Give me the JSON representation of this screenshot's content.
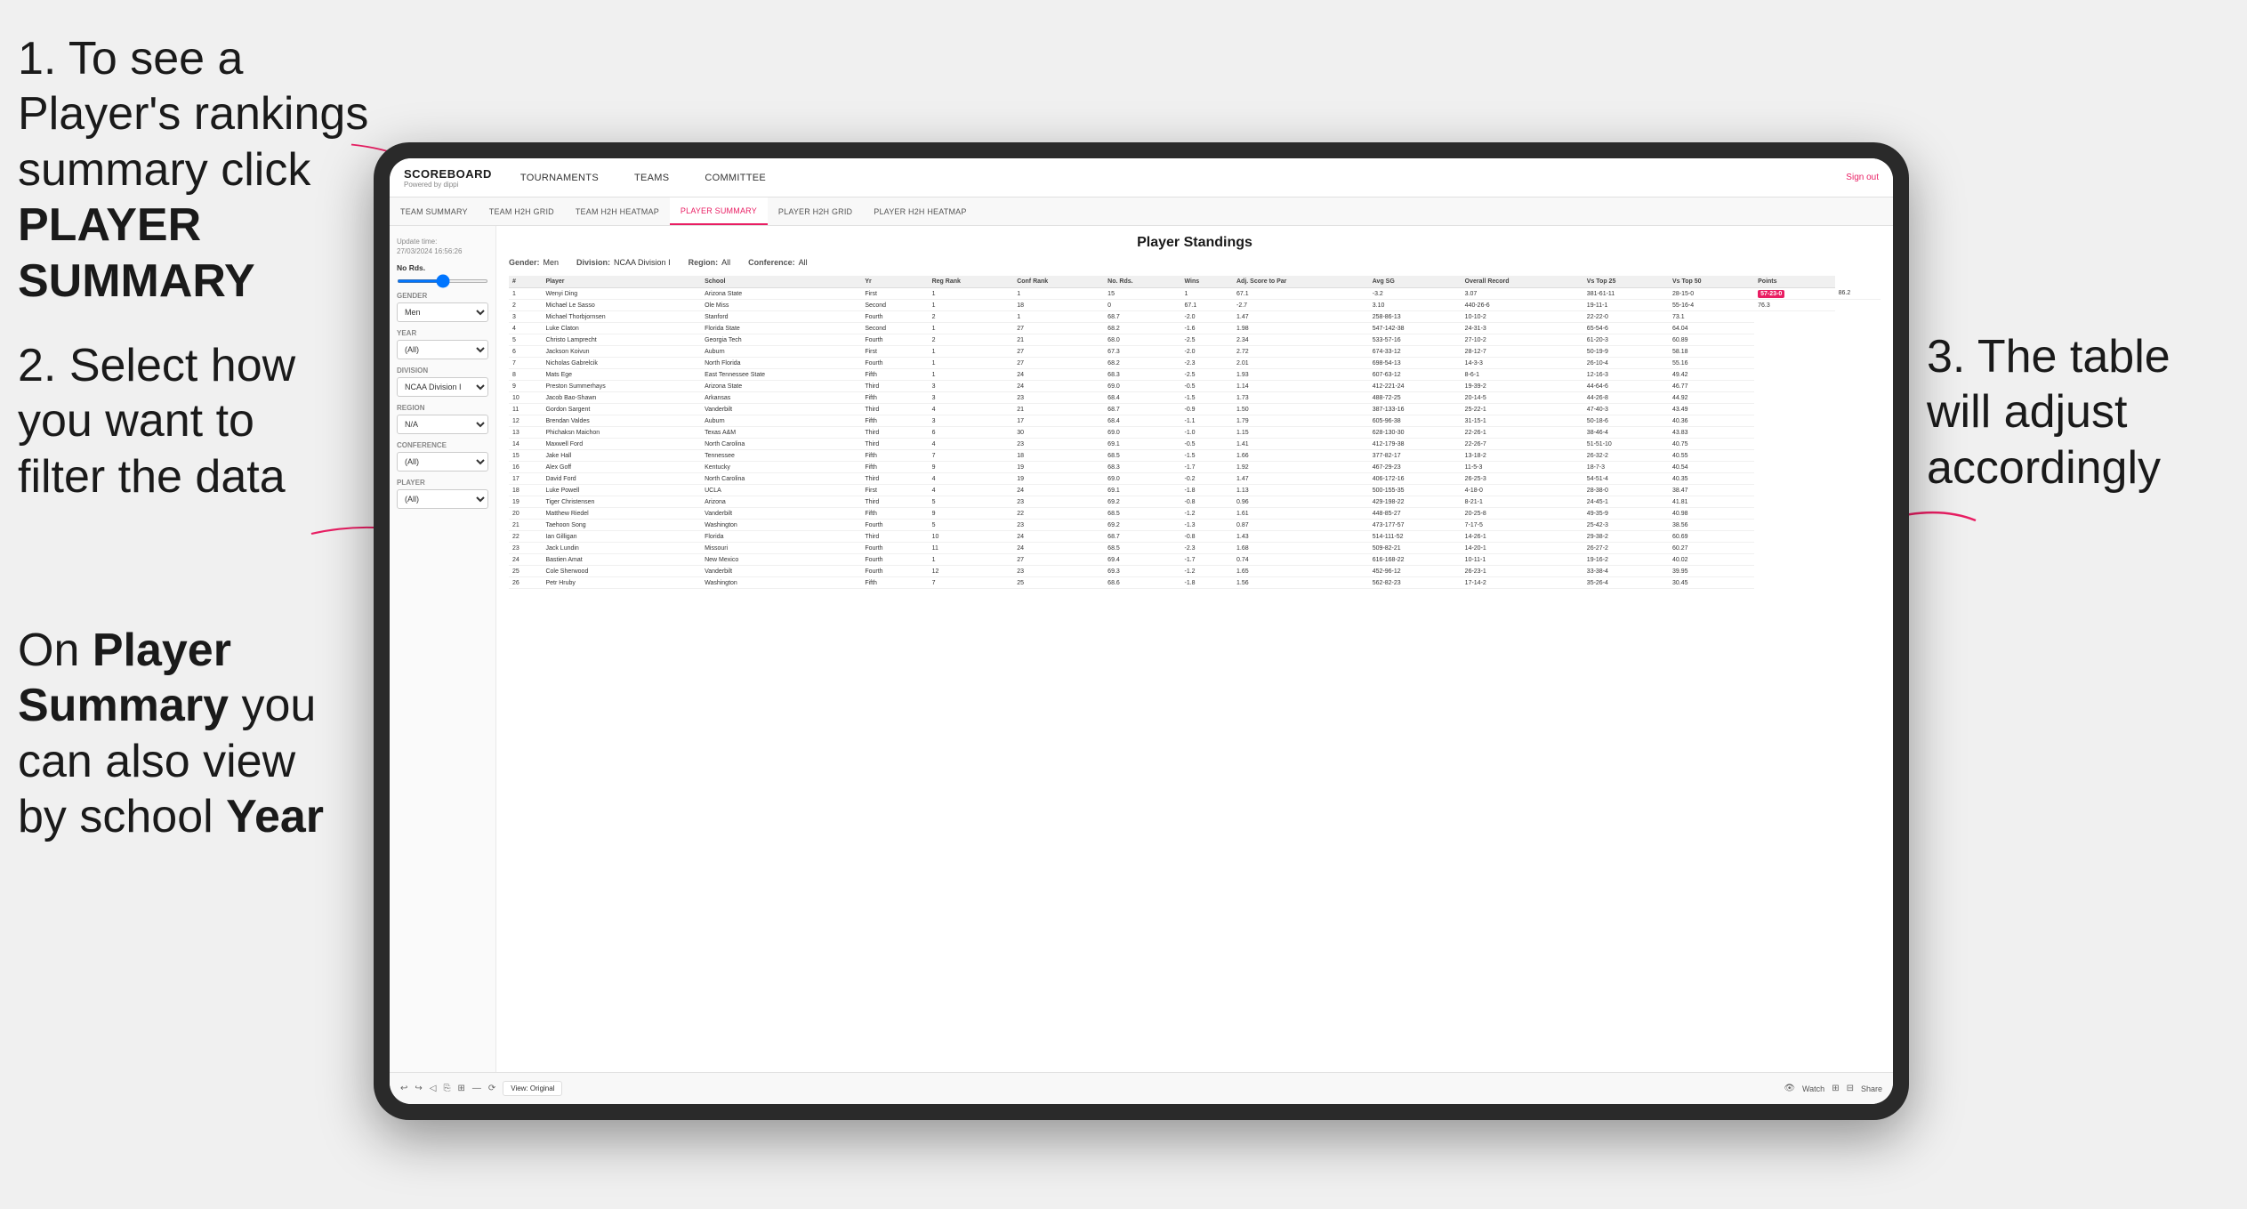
{
  "instructions": {
    "step1": "1. To see a Player's rankings summary click ",
    "step1_bold": "PLAYER SUMMARY",
    "step2": "2. Select how you want to filter the data",
    "step_bottom": "On ",
    "step_bottom_bold1": "Player Summary",
    "step_bottom_text": " you can also view by school ",
    "step_bottom_bold2": "Year",
    "step3": "3. The table will adjust accordingly"
  },
  "header": {
    "logo_title": "SCOREBOARD",
    "logo_sub": "Powered by dippi",
    "nav_items": [
      "TOURNAMENTS",
      "TEAMS",
      "COMMITTEE"
    ],
    "sign_in": "Sign out"
  },
  "sub_nav": {
    "items": [
      "TEAM SUMMARY",
      "TEAM H2H GRID",
      "TEAM H2H HEATMAP",
      "PLAYER SUMMARY",
      "PLAYER H2H GRID",
      "PLAYER H2H HEATMAP"
    ],
    "active": "PLAYER SUMMARY"
  },
  "sidebar": {
    "update_label": "Update time:",
    "update_time": "27/03/2024 16:56:26",
    "no_rds_label": "No Rds.",
    "gender_label": "Gender",
    "gender_value": "Men",
    "year_label": "Year",
    "year_value": "(All)",
    "division_label": "Division",
    "division_value": "NCAA Division I",
    "region_label": "Region",
    "region_value": "N/A",
    "conference_label": "Conference",
    "conference_value": "(All)",
    "player_label": "Player",
    "player_value": "(All)"
  },
  "standings": {
    "title": "Player Standings",
    "gender": "Men",
    "division": "NCAA Division I",
    "region": "All",
    "conference": "All",
    "columns": [
      "#",
      "Player",
      "School",
      "Yr",
      "Reg Rank",
      "Conf Rank",
      "No. Rds.",
      "Wins",
      "Adj. Score to Par",
      "Avg SG",
      "Overall Record",
      "Vs Top 25",
      "Vs Top 50",
      "Points"
    ],
    "rows": [
      [
        "1",
        "Wenyi Ding",
        "Arizona State",
        "First",
        "1",
        "1",
        "15",
        "1",
        "67.1",
        "-3.2",
        "3.07",
        "381-61-11",
        "28-15-0",
        "57-23-0",
        "86.2"
      ],
      [
        "2",
        "Michael Le Sasso",
        "Ole Miss",
        "Second",
        "1",
        "18",
        "0",
        "67.1",
        "-2.7",
        "3.10",
        "440-26-6",
        "19-11-1",
        "55-16-4",
        "76.3"
      ],
      [
        "3",
        "Michael Thorbjornsen",
        "Stanford",
        "Fourth",
        "2",
        "1",
        "68.7",
        "-2.0",
        "1.47",
        "258-86-13",
        "10-10-2",
        "22-22-0",
        "73.1"
      ],
      [
        "4",
        "Luke Claton",
        "Florida State",
        "Second",
        "1",
        "27",
        "68.2",
        "-1.6",
        "1.98",
        "547-142-38",
        "24-31-3",
        "65-54-6",
        "64.04"
      ],
      [
        "5",
        "Christo Lamprecht",
        "Georgia Tech",
        "Fourth",
        "2",
        "21",
        "68.0",
        "-2.5",
        "2.34",
        "533-57-16",
        "27-10-2",
        "61-20-3",
        "60.89"
      ],
      [
        "6",
        "Jackson Koivun",
        "Auburn",
        "First",
        "1",
        "27",
        "67.3",
        "-2.0",
        "2.72",
        "674-33-12",
        "28-12-7",
        "50-19-9",
        "58.18"
      ],
      [
        "7",
        "Nicholas Gabrelcik",
        "North Florida",
        "Fourth",
        "1",
        "27",
        "68.2",
        "-2.3",
        "2.01",
        "698-54-13",
        "14-3-3",
        "26-10-4",
        "55.16"
      ],
      [
        "8",
        "Mats Ege",
        "East Tennessee State",
        "Fifth",
        "1",
        "24",
        "68.3",
        "-2.5",
        "1.93",
        "607-63-12",
        "8-6-1",
        "12-16-3",
        "49.42"
      ],
      [
        "9",
        "Preston Summerhays",
        "Arizona State",
        "Third",
        "3",
        "24",
        "69.0",
        "-0.5",
        "1.14",
        "412-221-24",
        "19-39-2",
        "44-64-6",
        "46.77"
      ],
      [
        "10",
        "Jacob Bao-Shawn",
        "Arkansas",
        "Fifth",
        "3",
        "23",
        "68.4",
        "-1.5",
        "1.73",
        "488-72-25",
        "20-14-5",
        "44-26-8",
        "44.92"
      ],
      [
        "11",
        "Gordon Sargent",
        "Vanderbilt",
        "Third",
        "4",
        "21",
        "68.7",
        "-0.9",
        "1.50",
        "387-133-16",
        "25-22-1",
        "47-40-3",
        "43.49"
      ],
      [
        "12",
        "Brendan Valdes",
        "Auburn",
        "Fifth",
        "3",
        "17",
        "68.4",
        "-1.1",
        "1.79",
        "605-96-38",
        "31-15-1",
        "50-18-6",
        "40.36"
      ],
      [
        "13",
        "Phichaksn Maichon",
        "Texas A&M",
        "Third",
        "6",
        "30",
        "69.0",
        "-1.0",
        "1.15",
        "628-130-30",
        "22-26-1",
        "38-46-4",
        "43.83"
      ],
      [
        "14",
        "Maxwell Ford",
        "North Carolina",
        "Third",
        "4",
        "23",
        "69.1",
        "-0.5",
        "1.41",
        "412-179-38",
        "22-26-7",
        "51-51-10",
        "40.75"
      ],
      [
        "15",
        "Jake Hall",
        "Tennessee",
        "Fifth",
        "7",
        "18",
        "68.5",
        "-1.5",
        "1.66",
        "377-82-17",
        "13-18-2",
        "26-32-2",
        "40.55"
      ],
      [
        "16",
        "Alex Goff",
        "Kentucky",
        "Fifth",
        "9",
        "19",
        "68.3",
        "-1.7",
        "1.92",
        "467-29-23",
        "11-5-3",
        "18-7-3",
        "40.54"
      ],
      [
        "17",
        "David Ford",
        "North Carolina",
        "Third",
        "4",
        "19",
        "69.0",
        "-0.2",
        "1.47",
        "406-172-16",
        "26-25-3",
        "54-51-4",
        "40.35"
      ],
      [
        "18",
        "Luke Powell",
        "UCLA",
        "First",
        "4",
        "24",
        "69.1",
        "-1.8",
        "1.13",
        "500-155-35",
        "4-18-0",
        "28-38-0",
        "38.47"
      ],
      [
        "19",
        "Tiger Christensen",
        "Arizona",
        "Third",
        "5",
        "23",
        "69.2",
        "-0.8",
        "0.96",
        "429-198-22",
        "8-21-1",
        "24-45-1",
        "41.81"
      ],
      [
        "20",
        "Matthew Riedel",
        "Vanderbilt",
        "Fifth",
        "9",
        "22",
        "68.5",
        "-1.2",
        "1.61",
        "448-85-27",
        "20-25-8",
        "49-35-9",
        "40.98"
      ],
      [
        "21",
        "Taehoon Song",
        "Washington",
        "Fourth",
        "5",
        "23",
        "69.2",
        "-1.3",
        "0.87",
        "473-177-57",
        "7-17-5",
        "25-42-3",
        "38.56"
      ],
      [
        "22",
        "Ian Gilligan",
        "Florida",
        "Third",
        "10",
        "24",
        "68.7",
        "-0.8",
        "1.43",
        "514-111-52",
        "14-26-1",
        "29-38-2",
        "60.69"
      ],
      [
        "23",
        "Jack Lundin",
        "Missouri",
        "Fourth",
        "11",
        "24",
        "68.5",
        "-2.3",
        "1.68",
        "509-82-21",
        "14-20-1",
        "26-27-2",
        "60.27"
      ],
      [
        "24",
        "Bastien Amat",
        "New Mexico",
        "Fourth",
        "1",
        "27",
        "69.4",
        "-1.7",
        "0.74",
        "616-168-22",
        "10-11-1",
        "19-16-2",
        "40.02"
      ],
      [
        "25",
        "Cole Sherwood",
        "Vanderbilt",
        "Fourth",
        "12",
        "23",
        "69.3",
        "-1.2",
        "1.65",
        "452-96-12",
        "26-23-1",
        "33-38-4",
        "39.95"
      ],
      [
        "26",
        "Petr Hruby",
        "Washington",
        "Fifth",
        "7",
        "25",
        "68.6",
        "-1.8",
        "1.56",
        "562-82-23",
        "17-14-2",
        "35-26-4",
        "30.45"
      ]
    ]
  },
  "toolbar": {
    "view_original": "View: Original",
    "watch": "Watch",
    "share": "Share"
  }
}
